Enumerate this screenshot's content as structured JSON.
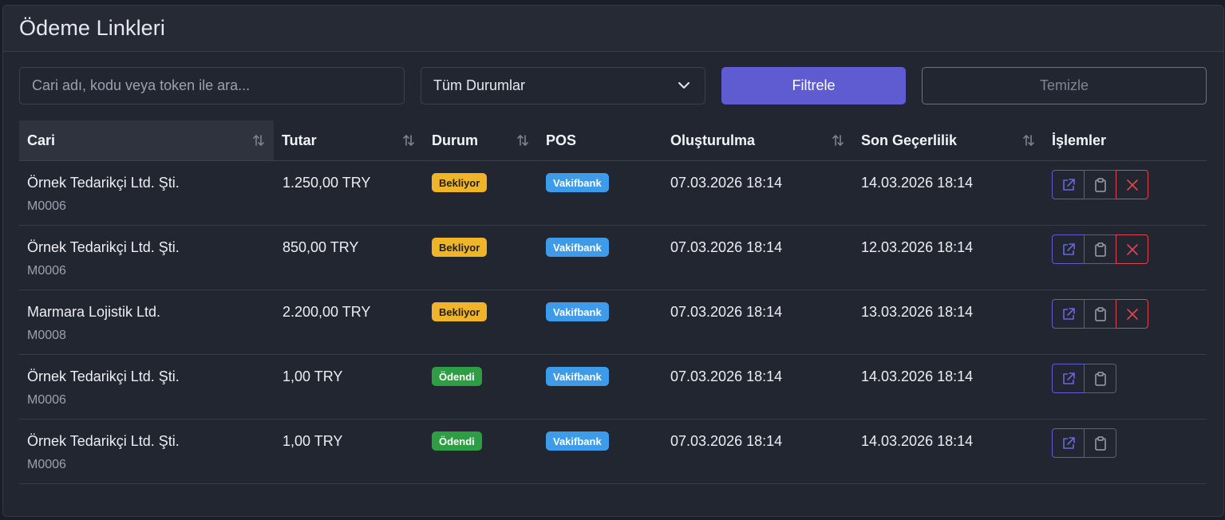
{
  "page": {
    "title": "Ödeme Linkleri"
  },
  "filters": {
    "search_placeholder": "Cari adı, kodu veya token ile ara...",
    "status_selected": "Tüm Durumlar",
    "filter_label": "Filtrele",
    "clear_label": "Temizle"
  },
  "table": {
    "columns": [
      "Cari",
      "Tutar",
      "Durum",
      "POS",
      "Oluşturulma",
      "Son Geçerlilik",
      "İşlemler"
    ],
    "rows": [
      {
        "cari": "Örnek Tedarikçi Ltd. Şti.",
        "code": "M0006",
        "amount": "1.250,00 TRY",
        "status": "Bekliyor",
        "pos": "Vakifbank",
        "created": "07.03.2026 18:14",
        "expires": "14.03.2026 18:14"
      },
      {
        "cari": "Örnek Tedarikçi Ltd. Şti.",
        "code": "M0006",
        "amount": "850,00 TRY",
        "status": "Bekliyor",
        "pos": "Vakifbank",
        "created": "07.03.2026 18:14",
        "expires": "12.03.2026 18:14"
      },
      {
        "cari": "Marmara Lojistik Ltd.",
        "code": "M0008",
        "amount": "2.200,00 TRY",
        "status": "Bekliyor",
        "pos": "Vakifbank",
        "created": "07.03.2026 18:14",
        "expires": "13.03.2026 18:14"
      },
      {
        "cari": "Örnek Tedarikçi Ltd. Şti.",
        "code": "M0006",
        "amount": "1,00 TRY",
        "status": "Ödendi",
        "pos": "Vakifbank",
        "created": "07.03.2026 18:14",
        "expires": "14.03.2026 18:14"
      },
      {
        "cari": "Örnek Tedarikçi Ltd. Şti.",
        "code": "M0006",
        "amount": "1,00 TRY",
        "status": "Ödendi",
        "pos": "Vakifbank",
        "created": "07.03.2026 18:14",
        "expires": "14.03.2026 18:14"
      }
    ]
  },
  "colors": {
    "pending": "#f0b429",
    "paid": "#2e9e44",
    "pos": "#3d9be9",
    "accent": "#5f5bd1",
    "danger": "#e0444f"
  }
}
